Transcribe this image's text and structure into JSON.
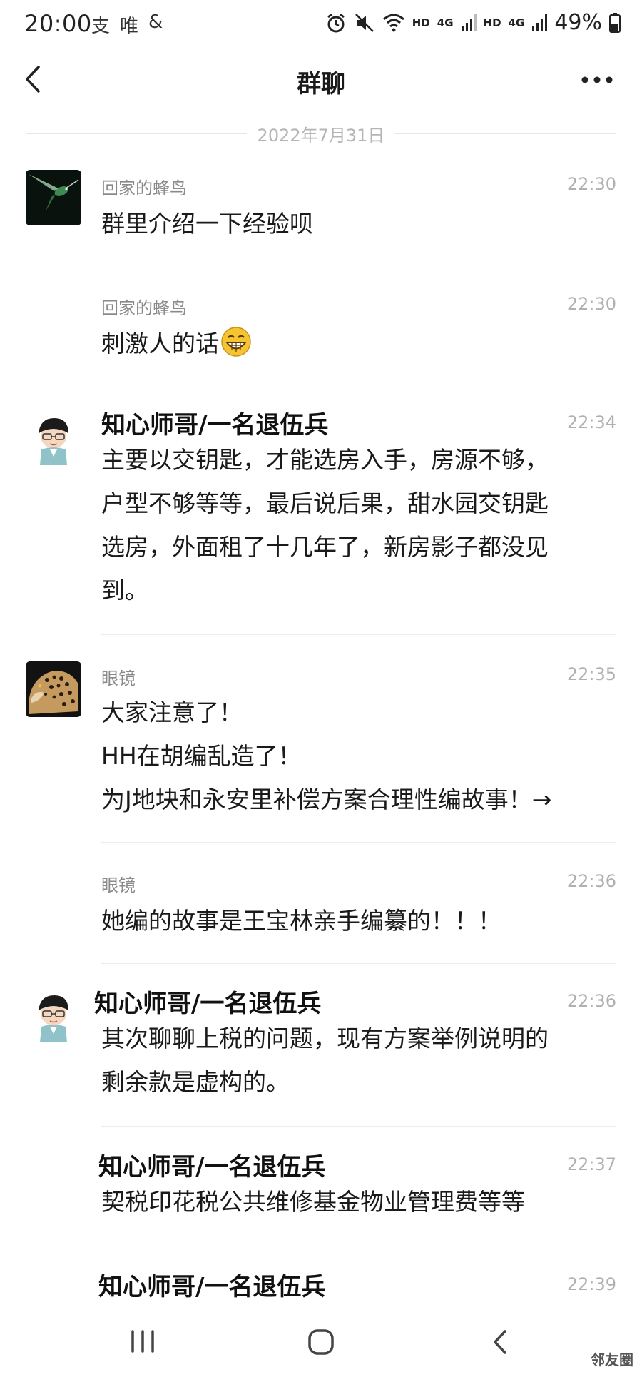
{
  "status_bar": {
    "time": "20:00",
    "app_icons": [
      "支",
      "唯",
      "&"
    ],
    "network_1": "HD",
    "network_2": "4G",
    "network_3": "HD",
    "network_4": "4G",
    "battery": "49%"
  },
  "nav": {
    "title": "群聊"
  },
  "date_separator": "2022年7月31日",
  "messages": [
    {
      "sender": "回家的蜂鸟",
      "time": "22:30",
      "lines": [
        "群里介绍一下经验呗"
      ],
      "avatar": "hummingbird-avatar"
    },
    {
      "sender": "回家的蜂鸟",
      "time": "22:30",
      "lines": [
        "刺激人的话"
      ],
      "emoji": "grinning-emoji"
    },
    {
      "sender": "知心师哥/一名退伍兵",
      "time": "22:34",
      "lines": [
        "主要以交钥匙，才能选房入手，房源不够，",
        "户型不够等等，最后说后果，甜水园交钥匙",
        "选房，外面租了十几年了，新房影子都没见",
        "到。"
      ],
      "avatar": "cartoon-boy-avatar"
    },
    {
      "sender": "眼镜",
      "time": "22:35",
      "lines": [
        "大家注意了！",
        "HH在胡编乱造了！",
        "为J地块和永安里补偿方案合理性编故事！→"
      ],
      "avatar": "leopard-avatar"
    },
    {
      "sender": "眼镜",
      "time": "22:36",
      "lines": [
        "她编的故事是王宝林亲手编纂的！！！"
      ]
    },
    {
      "sender": "知心师哥/一名退伍兵",
      "time": "22:36",
      "lines": [
        "其次聊聊上税的问题，现有方案举例说明的",
        "剩余款是虚构的。"
      ],
      "avatar": "cartoon-boy-avatar"
    },
    {
      "sender": "知心师哥/一名退伍兵",
      "time": "22:37",
      "lines": [
        "契税印花税公共维修基金物业管理费等等"
      ]
    },
    {
      "sender": "知心师哥/一名退伍兵",
      "time": "22:39",
      "lines": []
    }
  ],
  "watermark": "邻友圈",
  "bottom_nav": {
    "icons": [
      "recent-apps-icon",
      "home-icon",
      "back-icon"
    ]
  }
}
